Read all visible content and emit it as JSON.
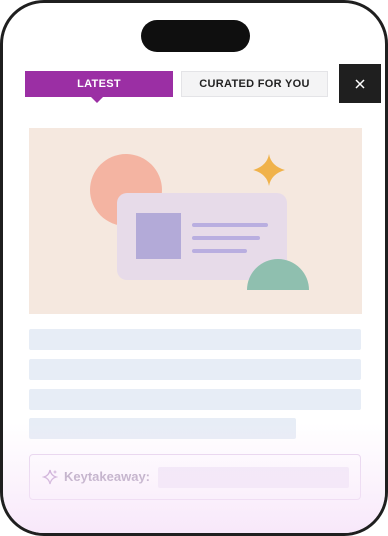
{
  "tabs": {
    "latest_label": "LATEST",
    "curated_label": "CURATED FOR YOU",
    "active": "latest"
  },
  "close_icon": "close-icon",
  "illustration": {
    "description_icon": "id-card-illustration",
    "colors": {
      "background": "#f5e8df",
      "circle": "#f4b4a2",
      "card": "#e7dbe9",
      "photo": "#b3aad8",
      "lines": "#b9aee0",
      "semicircle": "#8fbfaf",
      "sparkle": "#f0b24a"
    }
  },
  "takeaway": {
    "label": "Keytakeaway:",
    "icon": "sparkle-icon"
  },
  "colors": {
    "accent": "#9b2fa4",
    "skeleton": "#e7edf6",
    "device_frame": "#1f1f1f"
  }
}
